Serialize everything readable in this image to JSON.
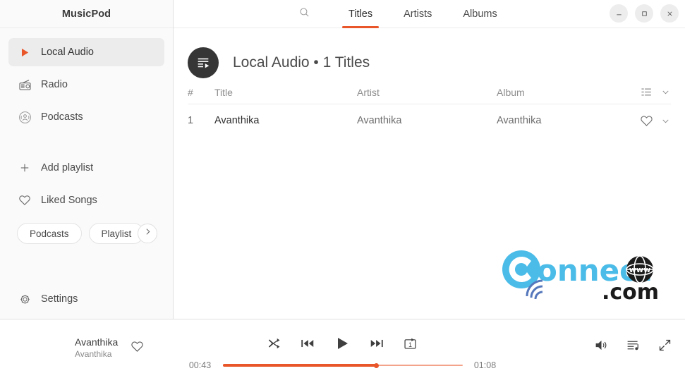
{
  "app": {
    "title": "MusicPod"
  },
  "sidebar": {
    "items": [
      {
        "label": "Local Audio",
        "icon": "play-triangle-icon",
        "selected": true
      },
      {
        "label": "Radio",
        "icon": "radio-icon",
        "selected": false
      },
      {
        "label": "Podcasts",
        "icon": "podcast-icon",
        "selected": false
      }
    ],
    "actions": [
      {
        "label": "Add playlist",
        "icon": "plus-icon"
      },
      {
        "label": "Liked Songs",
        "icon": "heart-icon"
      }
    ],
    "chips": [
      {
        "label": "Podcasts"
      },
      {
        "label": "Playlist"
      }
    ],
    "chip_next_icon": "chevron-right-icon",
    "settings": {
      "label": "Settings",
      "icon": "gear-icon"
    }
  },
  "topbar": {
    "search_icon": "search-icon",
    "tabs": [
      {
        "label": "Titles",
        "active": true
      },
      {
        "label": "Artists",
        "active": false
      },
      {
        "label": "Albums",
        "active": false
      }
    ],
    "window_controls": [
      {
        "name": "minimize-button",
        "glyph": "–"
      },
      {
        "name": "maximize-button",
        "glyph": "□"
      },
      {
        "name": "close-button",
        "glyph": "✕"
      }
    ]
  },
  "page": {
    "avatar_icon": "playlist-play-icon",
    "title": "Local Audio  •  1 Titles"
  },
  "table": {
    "columns": [
      "#",
      "Title",
      "Artist",
      "Album"
    ],
    "header_actions": [
      "queue-list-icon",
      "chevron-down-icon"
    ],
    "rows": [
      {
        "number": "1",
        "title": "Avanthika",
        "artist": "Avanthika",
        "album": "Avanthika",
        "actions": [
          "heart-icon",
          "chevron-down-icon"
        ]
      }
    ]
  },
  "watermark": {
    "text_main": "Connect",
    "text_sub": ".com",
    "text_www": "www",
    "color": "#4BBCE8"
  },
  "player": {
    "now_playing": {
      "title": "Avanthika",
      "artist": "Avanthika",
      "like_icon": "heart-icon"
    },
    "transport": [
      {
        "name": "shuffle-button",
        "icon": "shuffle-icon"
      },
      {
        "name": "previous-button",
        "icon": "skip-previous-icon"
      },
      {
        "name": "play-button",
        "icon": "play-icon"
      },
      {
        "name": "next-button",
        "icon": "skip-next-icon"
      },
      {
        "name": "repeat-one-button",
        "icon": "repeat-one-icon",
        "label": "1"
      }
    ],
    "right_controls": [
      {
        "name": "volume-button",
        "icon": "volume-icon"
      },
      {
        "name": "queue-button",
        "icon": "queue-music-icon"
      },
      {
        "name": "fullscreen-button",
        "icon": "fullscreen-icon"
      }
    ],
    "progress": {
      "elapsed": "00:43",
      "total": "01:08",
      "percent": 64
    }
  },
  "colors": {
    "accent": "#E8562A",
    "accent_track": "#F3A389",
    "sidebar_bg": "#FAFAFA",
    "selection": "#ECECEC"
  }
}
